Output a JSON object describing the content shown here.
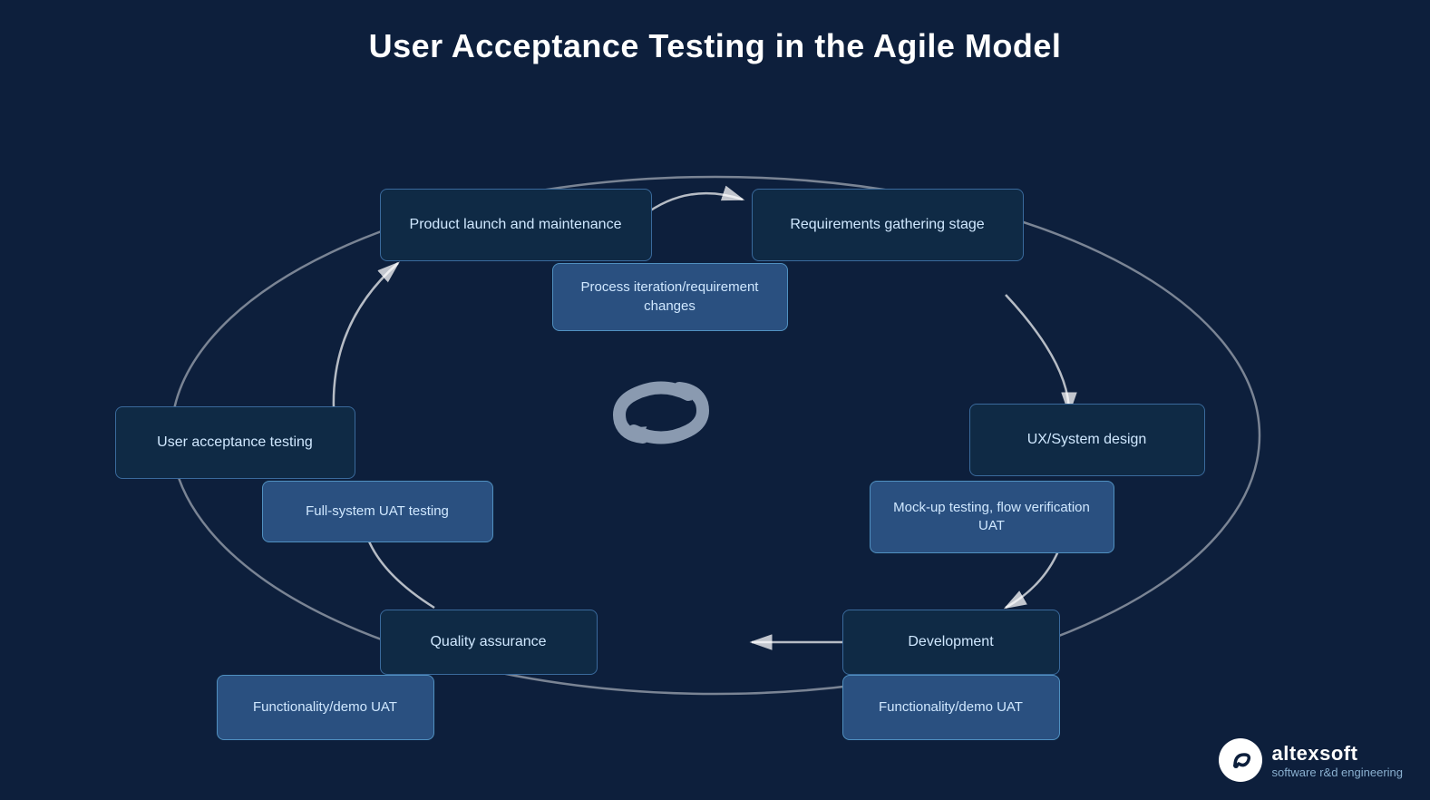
{
  "title": "User Acceptance Testing in the Agile Model",
  "boxes": {
    "product_launch": "Product launch and maintenance",
    "requirements": "Requirements gathering stage",
    "process_iteration": "Process iteration/requirement changes",
    "ux_design": "UX/System design",
    "mockup_testing": "Mock-up testing, flow verification UAT",
    "development": "Development",
    "functionality_demo_right": "Functionality/demo UAT",
    "quality_assurance": "Quality assurance",
    "functionality_demo_left": "Functionality/demo UAT",
    "user_acceptance": "User acceptance testing",
    "full_system_uat": "Full-system UAT testing"
  },
  "logo": {
    "name": "altexsoft",
    "subtitle": "software r&d engineering"
  }
}
